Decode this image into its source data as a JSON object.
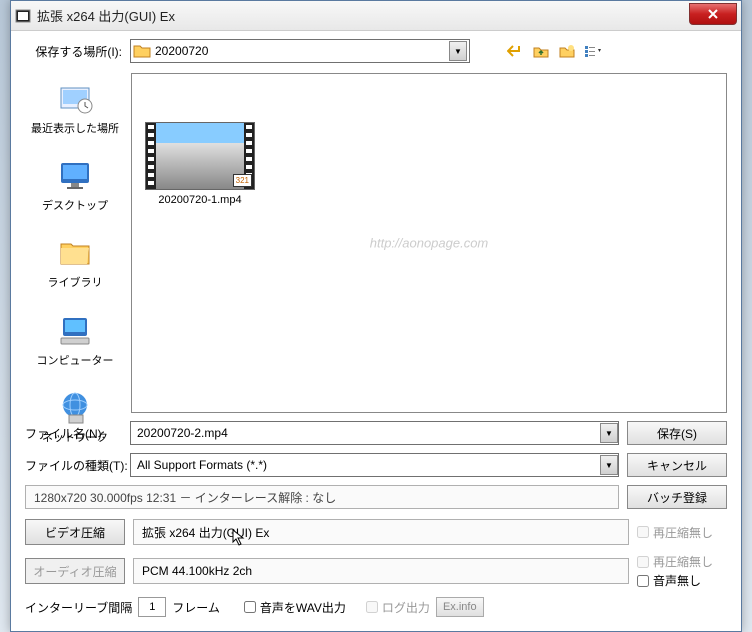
{
  "window": {
    "title": "拡張 x264 出力(GUI) Ex"
  },
  "saveLocation": {
    "label": "保存する場所(I):",
    "value": "20200720"
  },
  "sidebar": [
    {
      "label": "最近表示した場所"
    },
    {
      "label": "デスクトップ"
    },
    {
      "label": "ライブラリ"
    },
    {
      "label": "コンピューター"
    },
    {
      "label": "ネットワーク"
    }
  ],
  "file": {
    "badge": "321",
    "name": "20200720-1.mp4"
  },
  "watermark": "http://aonopage.com",
  "fields": {
    "filenameLabel": "ファイル名(N):",
    "filenameValue": "20200720-2.mp4",
    "filetypeLabel": "ファイルの種類(T):",
    "filetypeValue": "All Support Formats (*.*)"
  },
  "buttons": {
    "save": "保存(S)",
    "cancel": "キャンセル",
    "batch": "バッチ登録"
  },
  "info": "1280x720  30.000fps  12:31   －  インターレース解除 : なし",
  "videoCompress": {
    "button": "ビデオ圧縮",
    "text": "拡張 x264 出力(GUI) Ex",
    "recompress": "再圧縮無し"
  },
  "audioCompress": {
    "button": "オーディオ圧縮",
    "text": "PCM 44.100kHz 2ch",
    "recompress": "再圧縮無し",
    "noaudio": "音声無し"
  },
  "footer": {
    "interleave": "インターリーブ間隔",
    "frameValue": "1",
    "frameUnit": "フレーム",
    "wavOut": "音声をWAV出力",
    "logOut": "ログ出力",
    "exinfo": "Ex.info"
  }
}
